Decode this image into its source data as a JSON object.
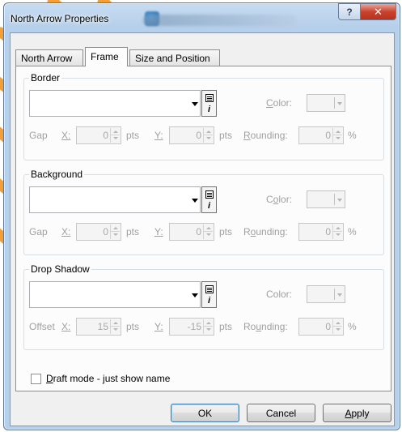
{
  "window": {
    "title": "North Arrow Properties",
    "help_glyph": "?",
    "close_glyph": "✕"
  },
  "tabs": [
    {
      "label": "North Arrow"
    },
    {
      "label": "Frame",
      "active": true
    },
    {
      "label": "Size and Position"
    }
  ],
  "groups": {
    "border": {
      "label": "Border",
      "color_label": "Color:",
      "row_label": "Gap",
      "x_label": "X:",
      "x_value": "0",
      "y_label": "Y:",
      "y_value": "0",
      "unit": "pts",
      "rounding_label": "Rounding:",
      "rounding_value": "0",
      "percent": "%"
    },
    "background": {
      "label": "Background",
      "color_label": "Color:",
      "row_label": "Gap",
      "x_label": "X:",
      "x_value": "0",
      "y_label": "Y:",
      "y_value": "0",
      "unit": "pts",
      "rounding_label": "Rounding:",
      "rounding_value": "0",
      "percent": "%"
    },
    "drop_shadow": {
      "label": "Drop Shadow",
      "color_label": "Color:",
      "row_label": "Offset",
      "x_label": "X:",
      "x_value": "15",
      "y_label": "Y:",
      "y_value": "-15",
      "unit": "pts",
      "rounding_label": "Rounding:",
      "rounding_value": "0",
      "percent": "%"
    }
  },
  "draft_mode": {
    "label": "Draft mode - just show name",
    "checked": false
  },
  "buttons": {
    "ok": "OK",
    "cancel": "Cancel",
    "apply": "Apply"
  },
  "colors": {
    "accent_stripe": "#f39a2b",
    "title_gradient": "#b6cfea",
    "close_button": "#c9442e"
  }
}
